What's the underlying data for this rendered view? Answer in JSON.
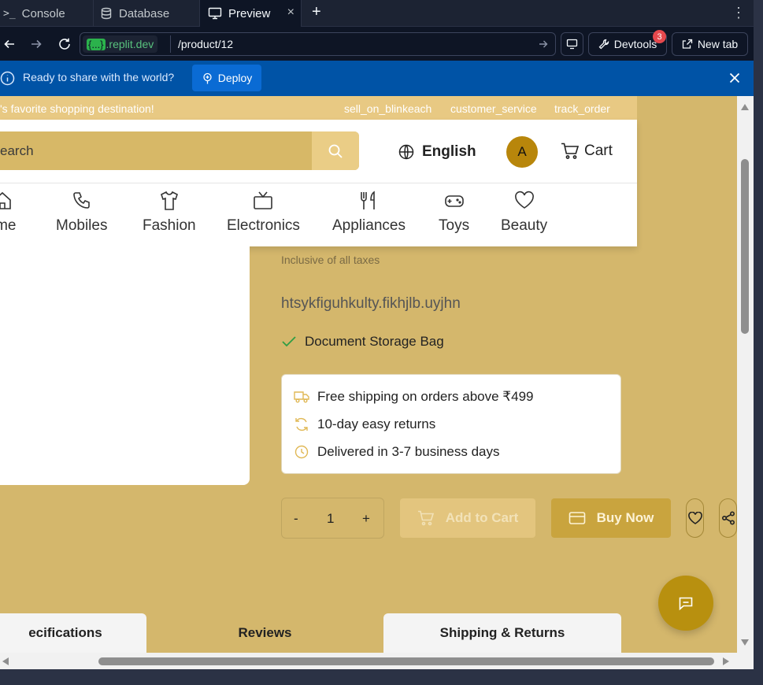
{
  "ide": {
    "tabs": [
      {
        "label": "Console",
        "icon": "terminal-icon"
      },
      {
        "label": "Database",
        "icon": "database-icon"
      },
      {
        "label": "Preview",
        "icon": "monitor-icon"
      }
    ],
    "close_symbol": "×",
    "add_symbol": "+",
    "menu_symbol": "⋮"
  },
  "urlbar": {
    "host_brace": "{...}",
    "host": ".replit.dev",
    "path": "/product/12",
    "devtools_label": "Devtools",
    "devtools_badge": "3",
    "newtab_label": "New tab"
  },
  "banner": {
    "text": "Ready to share with the world?",
    "deploy_label": "Deploy"
  },
  "store": {
    "top_strip": {
      "tagline": "'s favorite shopping destination!",
      "links": [
        "sell_on_blinkeach",
        "customer_service",
        "track_order"
      ]
    },
    "search_placeholder": "earch",
    "language": "English",
    "avatar_initial": "A",
    "cart_label": "Cart",
    "categories": [
      "ome",
      "Mobiles",
      "Fashion",
      "Electronics",
      "Appliances",
      "Toys",
      "Beauty"
    ]
  },
  "product": {
    "tax_note": "Inclusive of all taxes",
    "description": "htsykfiguhkulty.fikhjlb.uyjhn",
    "feature": "Document Storage Bag",
    "info": [
      "Free shipping on orders above ₹499",
      "10-day easy returns",
      "Delivered in 3-7 business days"
    ],
    "quantity": {
      "minus": "-",
      "value": "1",
      "plus": "+"
    },
    "add_to_cart": "Add to Cart",
    "buy_now": "Buy Now"
  },
  "product_tabs": [
    "ecifications",
    "Reviews",
    "Shipping & Returns"
  ],
  "colors": {
    "page_bg": "#d4b76c",
    "accent_gold": "#b8900f",
    "banner_blue": "#0053a6"
  }
}
